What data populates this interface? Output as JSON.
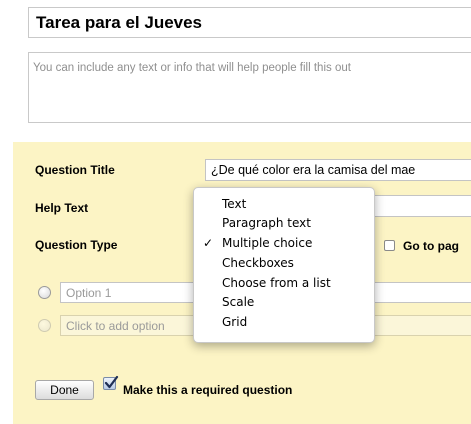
{
  "form": {
    "title": "Tarea para el Jueves",
    "description_placeholder": "You can include any text or info that will help people fill this out"
  },
  "question": {
    "title_label": "Question Title",
    "title_value": "¿De qué color era la camisa del mae",
    "help_label": "Help Text",
    "help_value": "",
    "type_label": "Question Type",
    "type_selected": "Multiple choice",
    "go_to_label": "Go to pag",
    "options": [
      {
        "placeholder": "Option 1"
      }
    ],
    "add_option_label": "Click to add option",
    "done_label": "Done",
    "required_label": "Make this a required question",
    "required_checked": true
  },
  "type_menu": {
    "items": [
      {
        "label": "Text",
        "selected": false
      },
      {
        "label": "Paragraph text",
        "selected": false
      },
      {
        "label": "Multiple choice",
        "selected": true
      },
      {
        "label": "Checkboxes",
        "selected": false
      },
      {
        "label": "Choose from a list",
        "selected": false
      },
      {
        "label": "Scale",
        "selected": false
      },
      {
        "label": "Grid",
        "selected": false
      }
    ],
    "checkmark": "✓"
  },
  "colors": {
    "panel_background": "#fcf4c5",
    "placeholder_text": "#8f8f8f"
  }
}
